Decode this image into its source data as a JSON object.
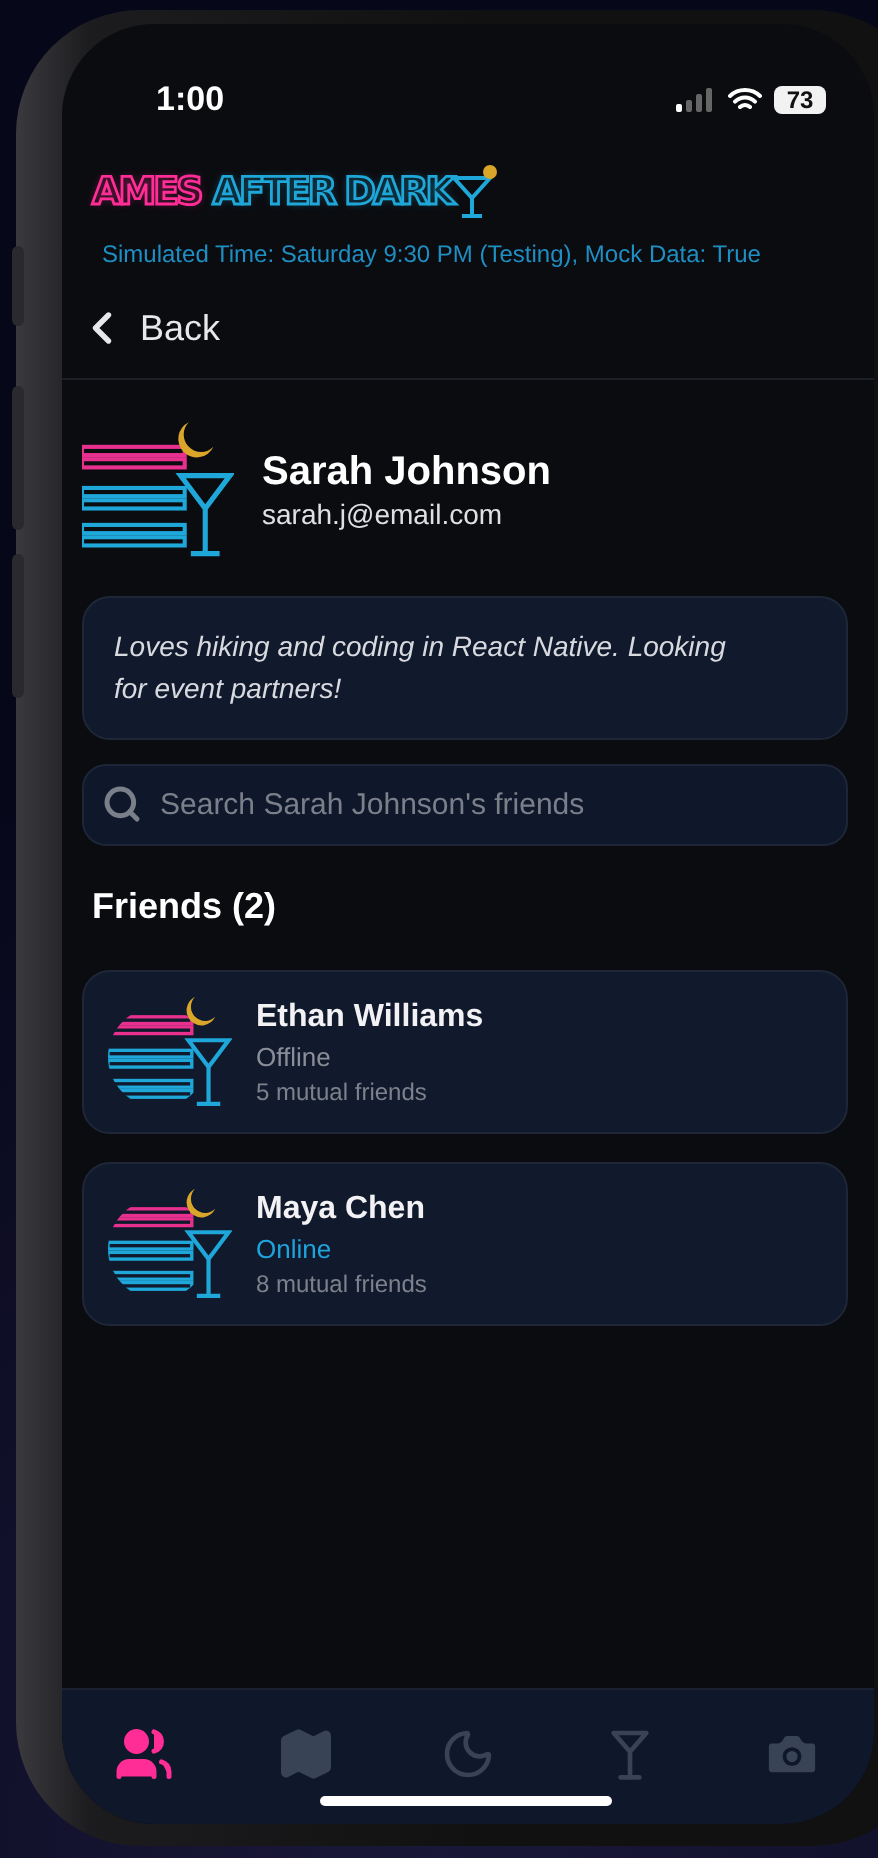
{
  "status_bar": {
    "time": "1:00",
    "battery": "73"
  },
  "header": {
    "logo": [
      "AMES",
      "AFTER DARK"
    ],
    "info": "Simulated Time: Saturday 9:30 PM (Testing), Mock Data: True"
  },
  "nav": {
    "back": "Back"
  },
  "profile": {
    "name": "Sarah Johnson",
    "email": "sarah.j@email.com",
    "bio": "Loves hiking and coding in React Native. Looking for event partners!"
  },
  "search": {
    "placeholder": "Search Sarah Johnson's friends"
  },
  "friends_heading": "Friends (2)",
  "friends": [
    {
      "name": "Ethan Williams",
      "status": "Offline",
      "online": false,
      "mutual": "5 mutual friends"
    },
    {
      "name": "Maya Chen",
      "status": "Online",
      "online": true,
      "mutual": "8 mutual friends"
    }
  ],
  "tabs": [
    {
      "kind": "friends",
      "selected": true
    },
    {
      "kind": "map",
      "selected": false
    },
    {
      "kind": "night",
      "selected": false
    },
    {
      "kind": "drinks",
      "selected": false
    },
    {
      "kind": "camera",
      "selected": false
    }
  ]
}
